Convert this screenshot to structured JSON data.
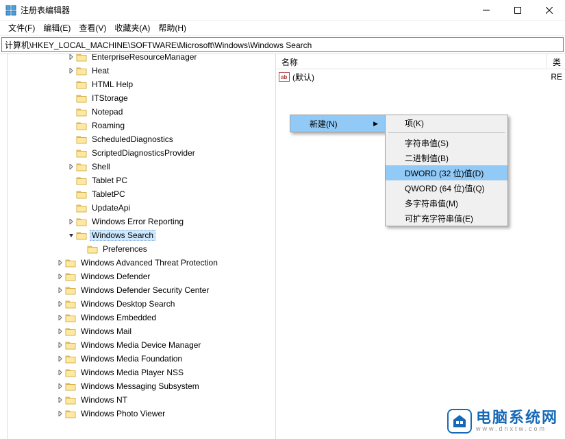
{
  "window": {
    "title": "注册表编辑器"
  },
  "menu": {
    "file": "文件(F)",
    "edit": "编辑(E)",
    "view": "查看(V)",
    "favorites": "收藏夹(A)",
    "help": "帮助(H)"
  },
  "address": "计算机\\HKEY_LOCAL_MACHINE\\SOFTWARE\\Microsoft\\Windows\\Windows Search",
  "tree": [
    {
      "indent": 5,
      "exp": ">",
      "label": "EnterpriseResourceManager"
    },
    {
      "indent": 5,
      "exp": ">",
      "label": "Heat"
    },
    {
      "indent": 5,
      "exp": "",
      "label": "HTML Help"
    },
    {
      "indent": 5,
      "exp": "",
      "label": "ITStorage"
    },
    {
      "indent": 5,
      "exp": "",
      "label": "Notepad"
    },
    {
      "indent": 5,
      "exp": "",
      "label": "Roaming"
    },
    {
      "indent": 5,
      "exp": "",
      "label": "ScheduledDiagnostics"
    },
    {
      "indent": 5,
      "exp": "",
      "label": "ScriptedDiagnosticsProvider"
    },
    {
      "indent": 5,
      "exp": ">",
      "label": "Shell"
    },
    {
      "indent": 5,
      "exp": "",
      "label": "Tablet PC"
    },
    {
      "indent": 5,
      "exp": "",
      "label": "TabletPC"
    },
    {
      "indent": 5,
      "exp": "",
      "label": "UpdateApi"
    },
    {
      "indent": 5,
      "exp": ">",
      "label": "Windows Error Reporting"
    },
    {
      "indent": 5,
      "exp": "v",
      "label": "Windows Search",
      "selected": true
    },
    {
      "indent": 6,
      "exp": "",
      "label": "Preferences"
    },
    {
      "indent": 4,
      "exp": ">",
      "label": "Windows Advanced Threat Protection"
    },
    {
      "indent": 4,
      "exp": ">",
      "label": "Windows Defender"
    },
    {
      "indent": 4,
      "exp": ">",
      "label": "Windows Defender Security Center"
    },
    {
      "indent": 4,
      "exp": ">",
      "label": "Windows Desktop Search"
    },
    {
      "indent": 4,
      "exp": ">",
      "label": "Windows Embedded"
    },
    {
      "indent": 4,
      "exp": ">",
      "label": "Windows Mail"
    },
    {
      "indent": 4,
      "exp": ">",
      "label": "Windows Media Device Manager"
    },
    {
      "indent": 4,
      "exp": ">",
      "label": "Windows Media Foundation"
    },
    {
      "indent": 4,
      "exp": ">",
      "label": "Windows Media Player NSS"
    },
    {
      "indent": 4,
      "exp": ">",
      "label": "Windows Messaging Subsystem"
    },
    {
      "indent": 4,
      "exp": ">",
      "label": "Windows NT"
    },
    {
      "indent": 4,
      "exp": ">",
      "label": "Windows Photo Viewer"
    }
  ],
  "list": {
    "col_name": "名称",
    "col_type": "类",
    "default_value": "(默认)",
    "type_prefix": "RE"
  },
  "context_menu": {
    "new": "新建(N)",
    "sub": {
      "key": "项(K)",
      "string": "字符串值(S)",
      "binary": "二进制值(B)",
      "dword": "DWORD (32 位)值(D)",
      "qword": "QWORD (64 位)值(Q)",
      "multi": "多字符串值(M)",
      "expand": "可扩充字符串值(E)"
    }
  },
  "watermark": {
    "main": "电脑系统网",
    "sub": "www.dnxtw.com"
  }
}
